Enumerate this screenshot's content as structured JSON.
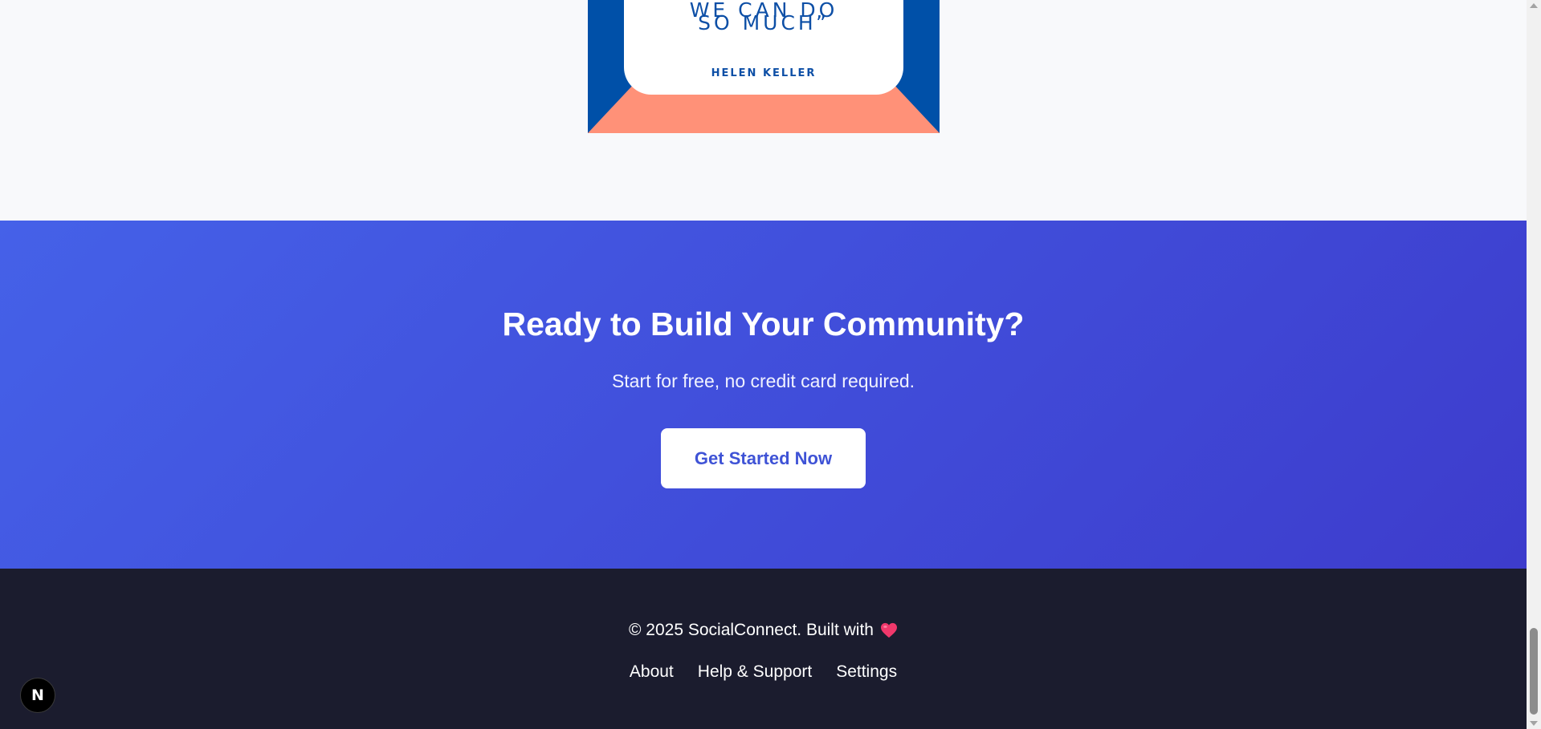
{
  "quote_image": {
    "line1": "WE CAN DO",
    "line2": "SO MUCH”",
    "author": "HELEN KELLER",
    "colors": {
      "frame": "#0050a8",
      "accent": "#ff9178",
      "card": "#ffffff",
      "text": "#0d4fa6"
    }
  },
  "cta": {
    "title": "Ready to Build Your Community?",
    "subtitle": "Start for free, no credit card required.",
    "button_label": "Get Started Now",
    "colors": {
      "gradient_start": "#4561e8",
      "gradient_end": "#3d3ccc",
      "button_text": "#3f53d6"
    }
  },
  "footer": {
    "copyright": "© 2025 SocialConnect. Built with",
    "heart_icon": "heart-icon",
    "links": [
      {
        "label": "About"
      },
      {
        "label": "Help & Support"
      },
      {
        "label": "Settings"
      }
    ],
    "colors": {
      "background": "#1b1c2e",
      "heart": "#f0386b"
    }
  },
  "dev_badge": {
    "label": "N",
    "icon": "nextjs-logo-icon"
  }
}
